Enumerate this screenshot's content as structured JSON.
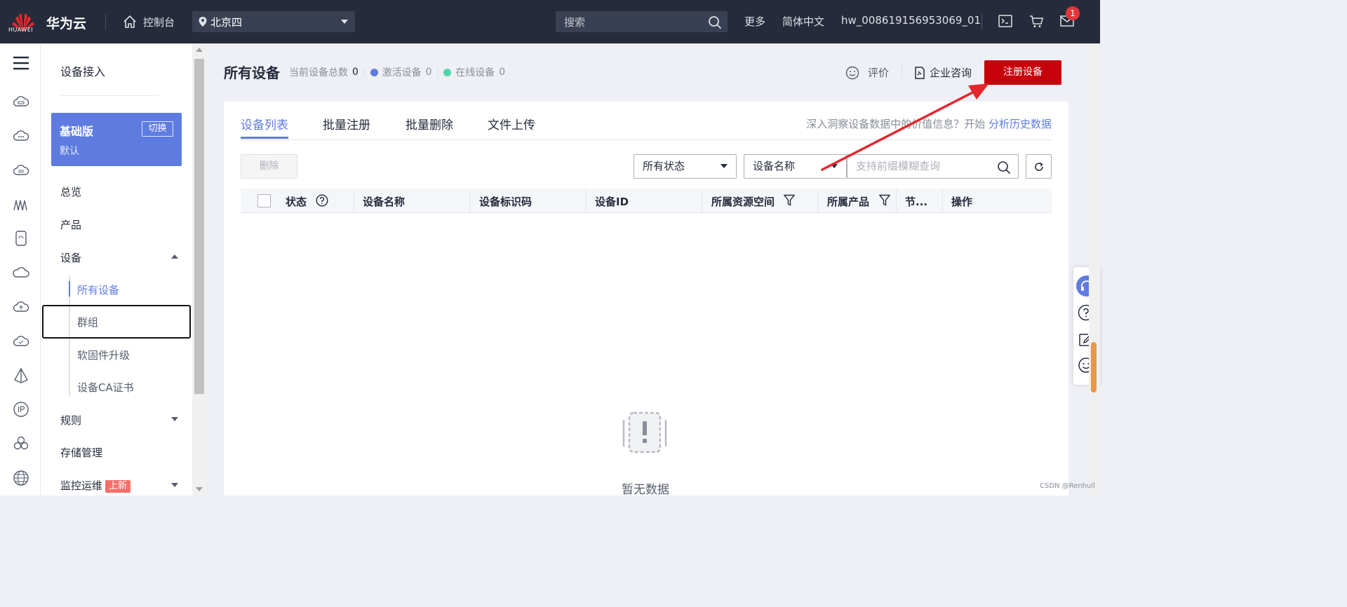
{
  "topbar": {
    "logo_text": "HUAWEI",
    "brand": "华为云",
    "console": "控制台",
    "region": "北京四",
    "search_placeholder": "搜索",
    "more": "更多",
    "language": "简体中文",
    "username": "hw_008619156953069_01",
    "mail_badge": "1"
  },
  "sidebar": {
    "title": "设备接入",
    "edition": "基础版",
    "edition_sub": "默认",
    "switch_label": "切换",
    "items": [
      {
        "label": "总览"
      },
      {
        "label": "产品"
      },
      {
        "label": "设备"
      },
      {
        "label": "规则"
      },
      {
        "label": "存储管理"
      },
      {
        "label": "监控运维",
        "tag": "上新"
      }
    ],
    "device_sub": [
      {
        "label": "所有设备"
      },
      {
        "label": "群组"
      },
      {
        "label": "软固件升级"
      },
      {
        "label": "设备CA证书"
      }
    ]
  },
  "page": {
    "title": "所有设备",
    "total_label": "当前设备总数",
    "total": "0",
    "active_label": "激活设备",
    "active": "0",
    "online_label": "在线设备",
    "online": "0",
    "rate_label": "评价",
    "consult_label": "企业咨询",
    "register_label": "注册设备"
  },
  "tabs": [
    {
      "label": "设备列表"
    },
    {
      "label": "批量注册"
    },
    {
      "label": "批量删除"
    },
    {
      "label": "文件上传"
    }
  ],
  "insight": {
    "text": "深入洞察设备数据中的价值信息？开始",
    "link": "分析历史数据"
  },
  "toolbar": {
    "delete_label": "删除",
    "status_filter": "所有状态",
    "field_filter": "设备名称",
    "search_placeholder": "支持前缀模糊查询"
  },
  "table": {
    "columns": [
      "状态",
      "设备名称",
      "设备标识码",
      "设备ID",
      "所属资源空间",
      "所属产品",
      "节...",
      "操作"
    ],
    "rows": [],
    "empty_text": "暂无数据"
  },
  "watermark": "CSDN @Renhuil",
  "colors": {
    "topbar": "#252b3a",
    "accent": "#5e7ce0",
    "register": "#c7000b",
    "active_dot": "#5e7ce0",
    "online_dot": "#50d4ab",
    "annotation_arrow": "#e5262d"
  }
}
